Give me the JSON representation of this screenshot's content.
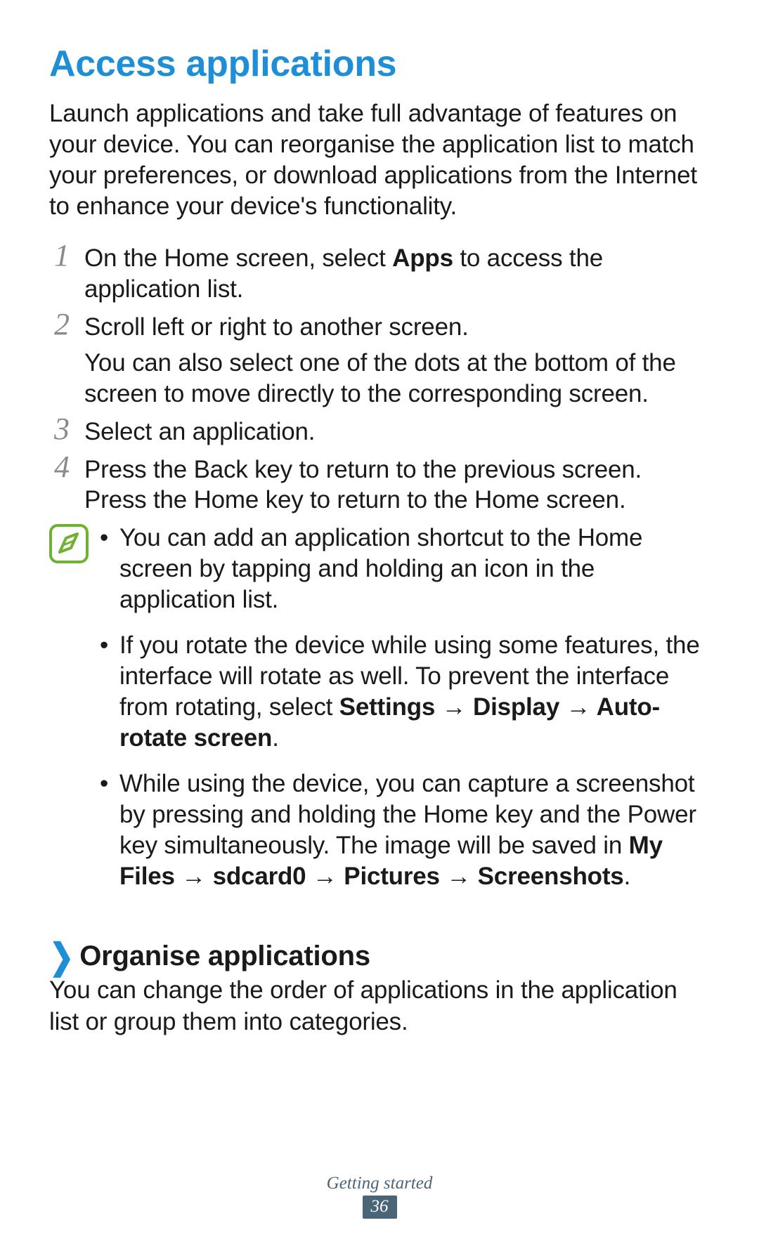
{
  "title": "Access applications",
  "intro": "Launch applications and take full advantage of features on your device. You can reorganise the application list to match your preferences, or download applications from the Internet to enhance your device's functionality.",
  "steps": {
    "s1": {
      "num": "1",
      "text_a": "On the Home screen, select ",
      "bold": "Apps",
      "text_b": " to access the application list."
    },
    "s2": {
      "num": "2",
      "line1": "Scroll left or right to another screen.",
      "line2": "You can also select one of the dots at the bottom of the screen to move directly to the corresponding screen."
    },
    "s3": {
      "num": "3",
      "text": "Select an application."
    },
    "s4": {
      "num": "4",
      "text": "Press the Back key to return to the previous screen. Press the Home key to return to the Home screen."
    }
  },
  "notes": {
    "n1": "You can add an application shortcut to the Home screen by tapping and holding an icon in the application list.",
    "n2_a": "If you rotate the device while using some features, the interface will rotate as well. To prevent the interface from rotating, select ",
    "n2_bold": "Settings → Display → Auto-rotate screen",
    "n2_b": ".",
    "n3_a": "While using the device, you can capture a screenshot by pressing and holding the Home key and the Power key simultaneously. The image will be saved in ",
    "n3_bold": "My Files → sdcard0 → Pictures → Screenshots",
    "n3_b": "."
  },
  "subhead": "Organise applications",
  "chevron": "❯",
  "subintro": "You can change the order of applications in the application list or group them into categories.",
  "footer": {
    "section": "Getting started",
    "page": "36"
  },
  "icons": {
    "note": "note-icon"
  },
  "bullet": "•"
}
